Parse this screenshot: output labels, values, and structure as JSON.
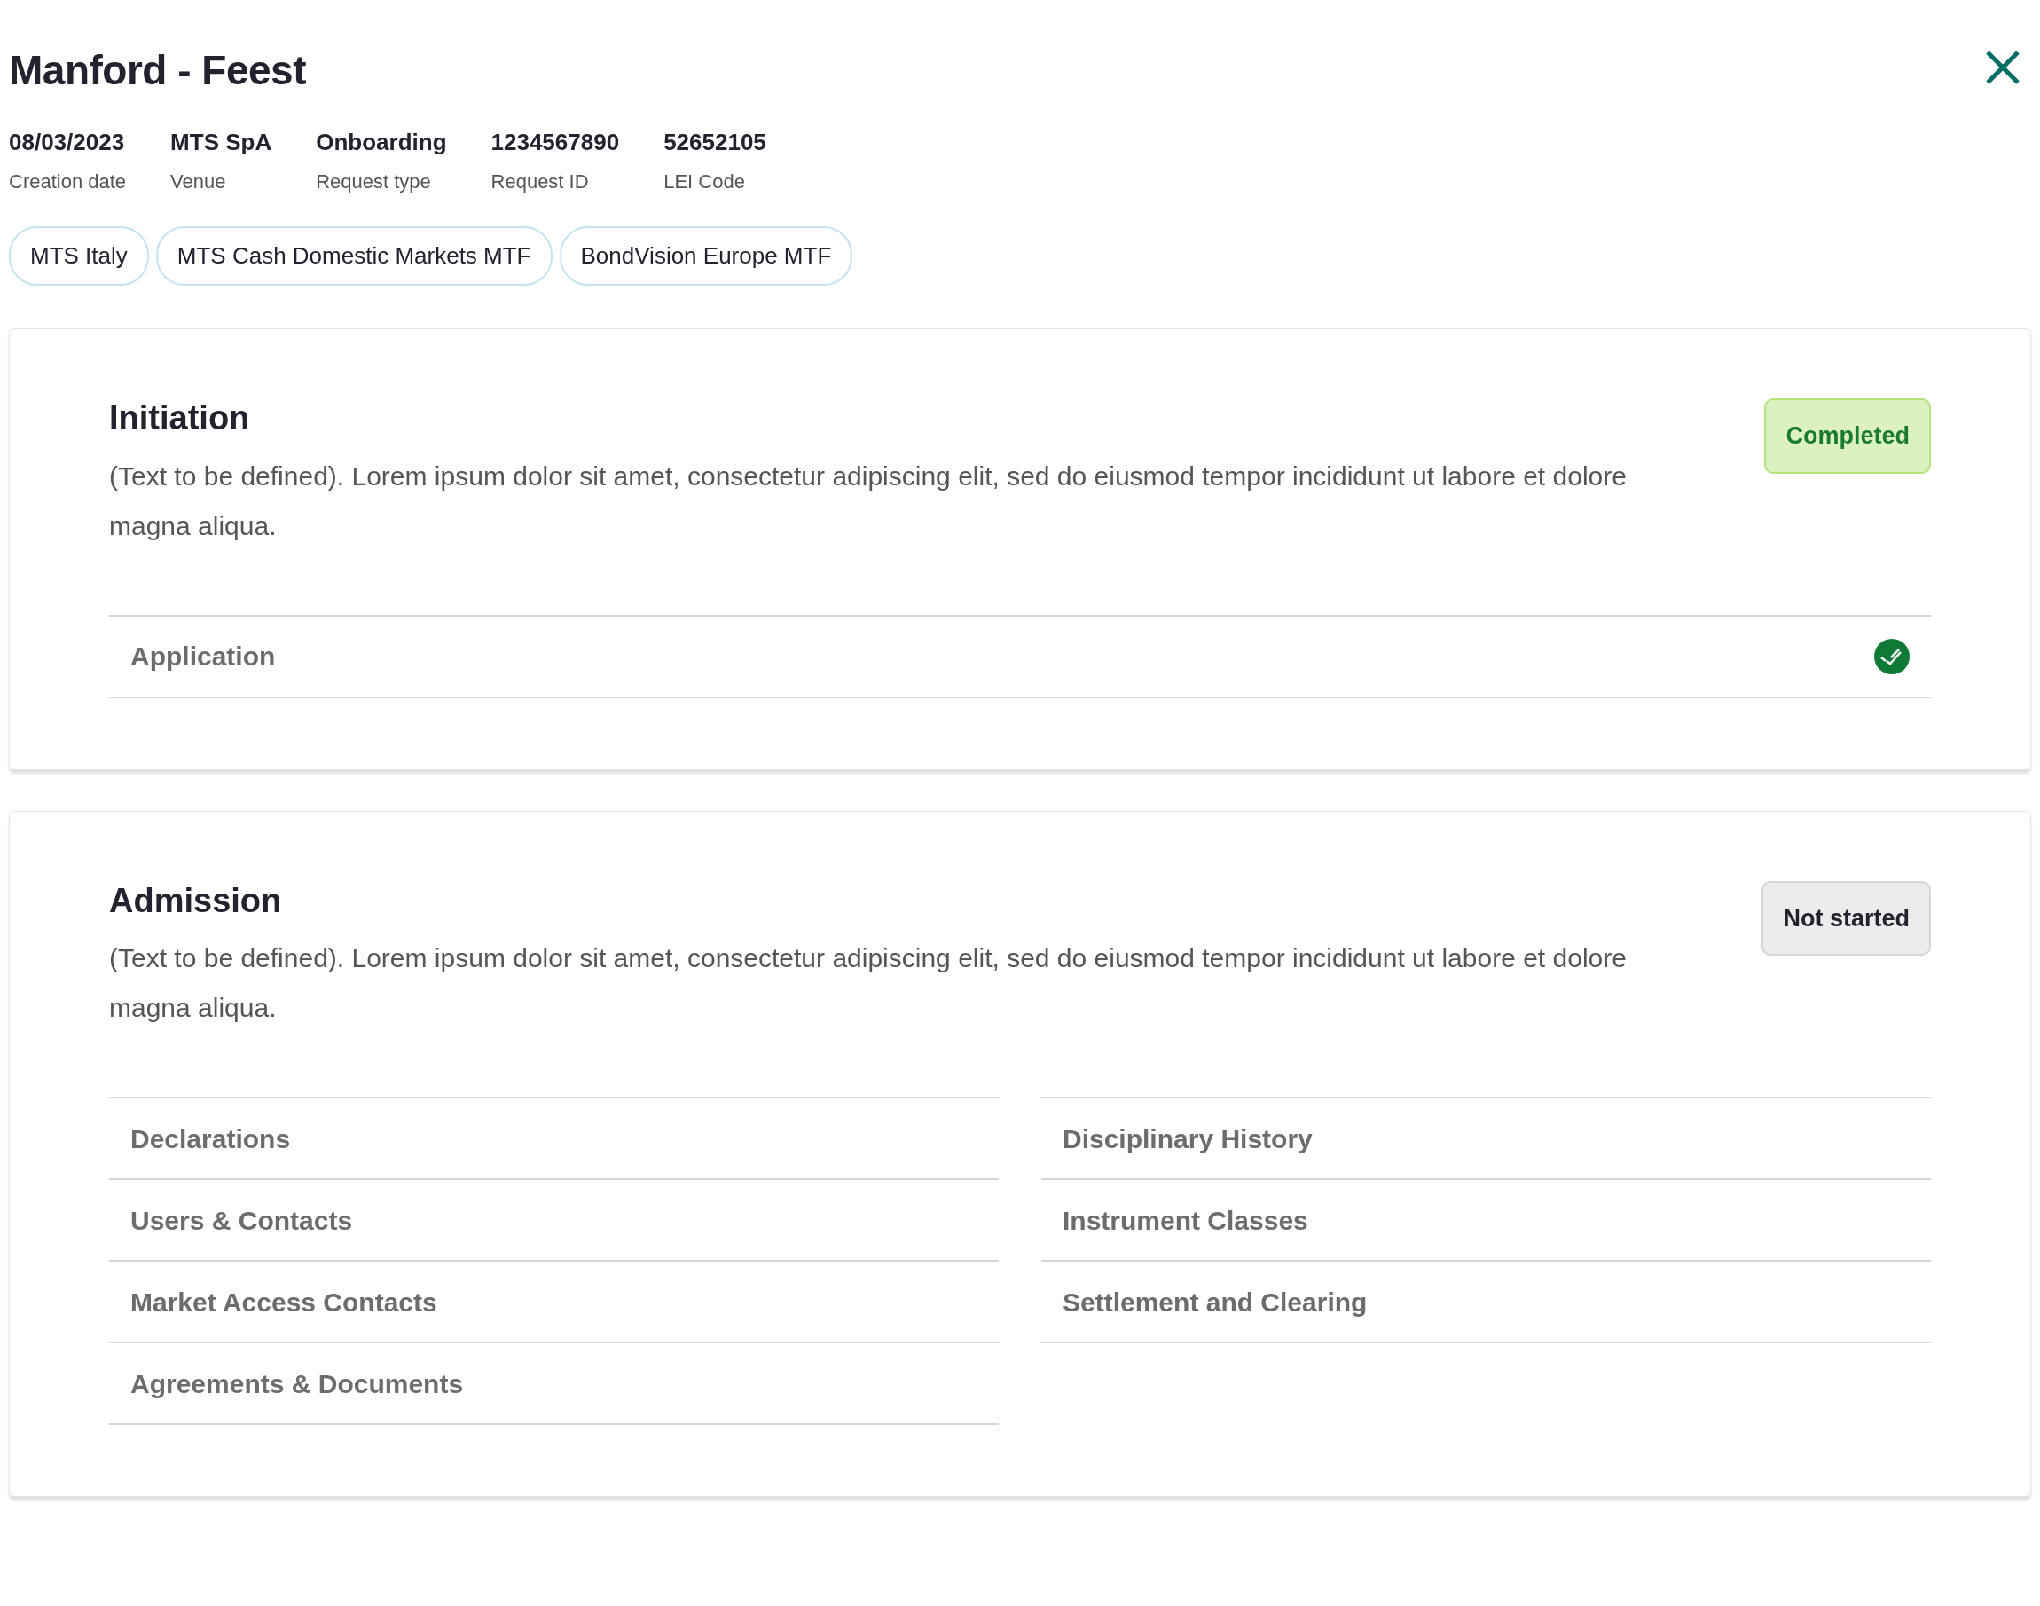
{
  "header": {
    "title": "Manford - Feest"
  },
  "meta": [
    {
      "value": "08/03/2023",
      "label": "Creation date"
    },
    {
      "value": "MTS SpA",
      "label": "Venue"
    },
    {
      "value": "Onboarding",
      "label": "Request type"
    },
    {
      "value": "1234567890",
      "label": "Request ID"
    },
    {
      "value": "52652105",
      "label": "LEI Code"
    }
  ],
  "chips": [
    "MTS Italy",
    "MTS Cash Domestic Markets MTF",
    "BondVision Europe MTF"
  ],
  "sections": [
    {
      "title": "Initiation",
      "description": "(Text to be defined). Lorem ipsum dolor sit amet, consectetur adipiscing elit, sed do eiusmod tempor incididunt ut labore et dolore magna aliqua.",
      "status": {
        "label": "Completed",
        "kind": "completed"
      },
      "steps": [
        {
          "label": "Application",
          "done": true
        }
      ]
    },
    {
      "title": "Admission",
      "description": "(Text to be defined). Lorem ipsum dolor sit amet, consectetur adipiscing elit, sed do eiusmod tempor incididunt ut labore et dolore magna aliqua.",
      "status": {
        "label": "Not started",
        "kind": "not_started"
      },
      "steps": [
        {
          "label": "Declarations",
          "done": false
        },
        {
          "label": "Disciplinary History",
          "done": false
        },
        {
          "label": "Users & Contacts",
          "done": false
        },
        {
          "label": "Instrument Classes",
          "done": false
        },
        {
          "label": "Market Access Contacts",
          "done": false
        },
        {
          "label": "Settlement and Clearing",
          "done": false
        },
        {
          "label": "Agreements & Documents",
          "done": false
        }
      ]
    }
  ]
}
